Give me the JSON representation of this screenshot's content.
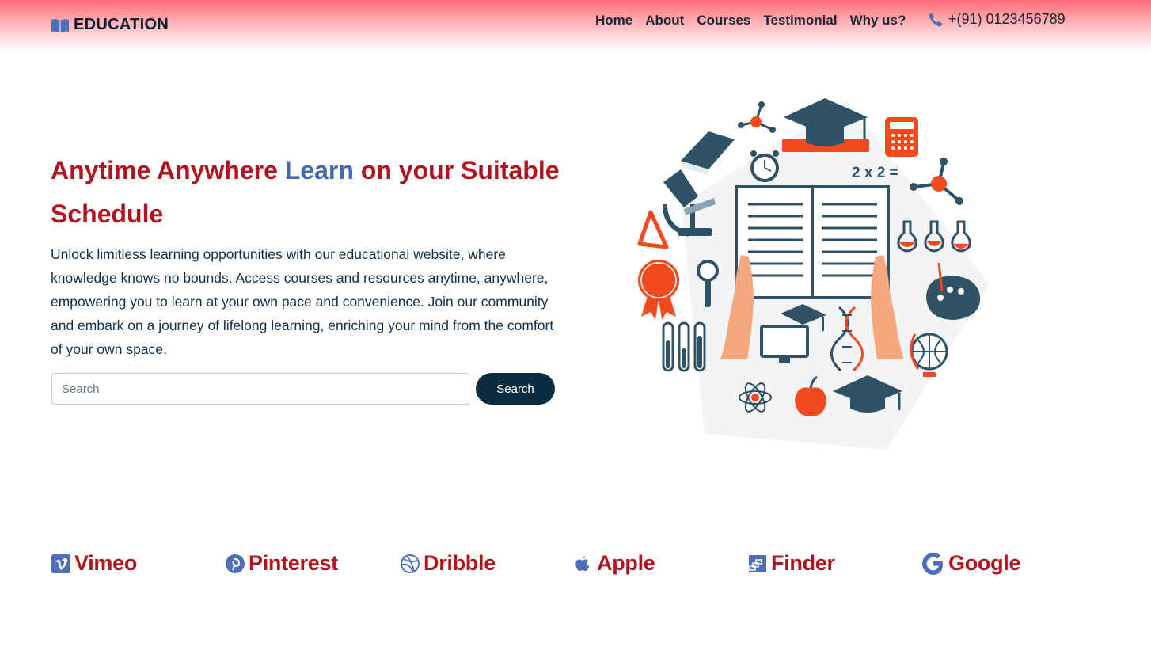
{
  "header": {
    "brand": "EDUCATION",
    "nav": [
      "Home",
      "About",
      "Courses",
      "Testimonial",
      "Why us?"
    ],
    "phone": "+(91) 0123456789"
  },
  "hero": {
    "title_part1": "Anytime Anywhere ",
    "title_accent": "Learn",
    "title_part2": " on your Suitable Schedule",
    "description": "Unlock limitless learning opportunities with our educational website, where knowledge knows no bounds. Access courses and resources anytime, anywhere, empowering you to learn at your own pace and convenience. Join our community and embark on a journey of lifelong learning, enriching your mind from the comfort of your own space.",
    "search_placeholder": "Search",
    "search_button": "Search",
    "illustration_text": "2 x 2 ="
  },
  "brands": [
    {
      "name": "Vimeo",
      "icon": "vimeo-icon"
    },
    {
      "name": "Pinterest",
      "icon": "pinterest-icon"
    },
    {
      "name": "Dribble",
      "icon": "dribbble-icon"
    },
    {
      "name": "Apple",
      "icon": "apple-icon"
    },
    {
      "name": "Finder",
      "icon": "finder-icon"
    },
    {
      "name": "Google",
      "icon": "google-icon"
    }
  ],
  "colors": {
    "accent_red": "#b3131f",
    "accent_blue": "#4668b4",
    "dark_navy": "#0b2c3f",
    "illustration_slate": "#2f5266",
    "illustration_orange": "#f04a1e"
  }
}
